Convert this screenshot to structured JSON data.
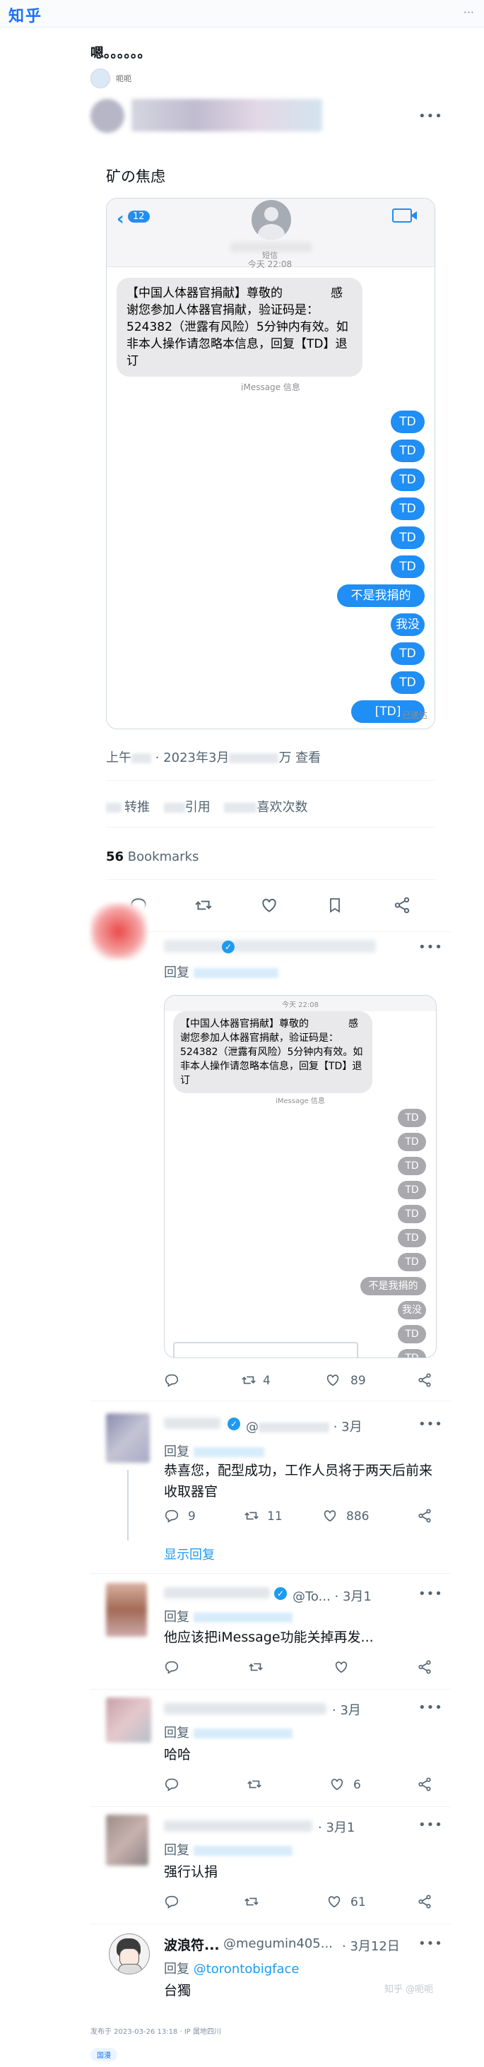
{
  "topbar": {
    "logo": "知乎",
    "dots": "···"
  },
  "post": {
    "title": "嗯。。。。。。",
    "author": "呃呃"
  },
  "tweet": {
    "text": "矿の焦虑",
    "time_prefix": "上午",
    "date": "2023年3月",
    "views_suffix": "万 查看",
    "retweets_label": "转推",
    "quotes_label": "引用",
    "likes_label": "喜欢次数",
    "bookmarks_count": "56",
    "bookmarks_label": "Bookmarks"
  },
  "sms": {
    "back_count": "12",
    "contact": "短信",
    "today": "今天 22:08",
    "message": "【中国人体器官捐献】尊敬的　　　　感谢您参加人体器官捐献，验证码是：524382（泄露有风险）5分钟内有效。如非本人操作请忽略本信息，回复【TD】退订",
    "service": "iMessage 信息",
    "replies": [
      "TD",
      "TD",
      "TD",
      "TD",
      "TD",
      "TD",
      "不是我捐的",
      "我没捐",
      "TD",
      "TD",
      "[TD]"
    ],
    "delivered": "已送达"
  },
  "reply1": {
    "reply_to": "回复",
    "sms_today": "今天 22:08",
    "sms_service": "iMessage 信息",
    "gray_replies": [
      "TD",
      "TD",
      "TD",
      "TD",
      "TD",
      "TD",
      "TD",
      "不是我捐的",
      "我没捐",
      "TD",
      "TD"
    ],
    "retweets": "4",
    "likes": "89"
  },
  "reply2": {
    "handle": "@",
    "date": "3月",
    "reply_to": "回复",
    "text": "恭喜您，配型成功，工作人员将于两天后前来收取器官",
    "replies": "9",
    "retweets": "11",
    "likes": "886",
    "show_replies": "显示回复"
  },
  "reply3": {
    "handle": "@To...",
    "date": "3月1",
    "reply_to": "回复",
    "text": "他应该把iMessage功能关掉再发..."
  },
  "reply4": {
    "date": "3月",
    "reply_to": "回复",
    "text": "哈哈",
    "likes": "6"
  },
  "reply5": {
    "date": "3月1",
    "reply_to": "回复",
    "text": "强行认捐",
    "likes": "61"
  },
  "reply6": {
    "name": "波浪符...",
    "handle": "@megumin405...",
    "date": "· 3月12日",
    "reply_to": "回复",
    "reply_handle": "@torontobigface",
    "text": "台獨"
  },
  "watermark": "知乎 @呃呃",
  "footer": {
    "edited": "发布于 2023-03-26 13:18 · IP 属地四川",
    "tag": "国漫"
  },
  "colors": {
    "accent": "#1d9bf0",
    "imessage_blue": "#1f8ef5",
    "zhihu_blue": "#1772f6"
  }
}
